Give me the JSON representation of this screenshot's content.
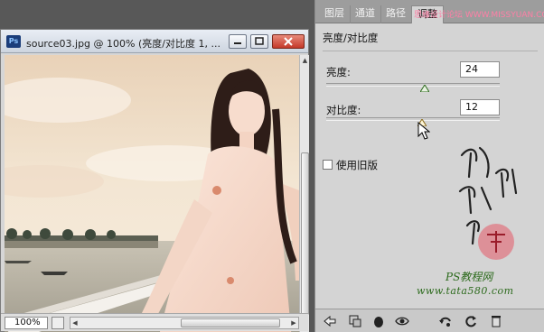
{
  "document": {
    "title": "source03.jpg @ 100% (亮度/对比度 1, ...",
    "app_badge": "Ps",
    "zoom": "100%"
  },
  "panel": {
    "tabs": [
      {
        "label": "图层"
      },
      {
        "label": "通道"
      },
      {
        "label": "路径"
      },
      {
        "label": "调整"
      }
    ],
    "title": "亮度/对比度",
    "brightness": {
      "label": "亮度:",
      "value": "24",
      "slider_fraction": 0.57
    },
    "contrast": {
      "label": "对比度:",
      "value": "12",
      "slider_fraction": 0.55
    },
    "legacy_checkbox": {
      "label": "使用旧版",
      "checked": false
    }
  },
  "watermark": {
    "top": "思缘设计论坛 WWW.MISSYUAN.COM",
    "brand": "PS教程网",
    "url": "www.tata580.com"
  },
  "colors": {
    "panel_bg": "#d4d4d4",
    "close_red": "#c4392a",
    "watermark_pink": "#ff7fa6",
    "brand_green": "#2c6a1c"
  },
  "icons": [
    "minimize-icon",
    "maximize-icon",
    "close-icon",
    "back-arrow-icon",
    "clip-layer-icon",
    "visibility-icon",
    "eye-icon",
    "view-previous-icon",
    "reset-icon",
    "trash-icon"
  ]
}
